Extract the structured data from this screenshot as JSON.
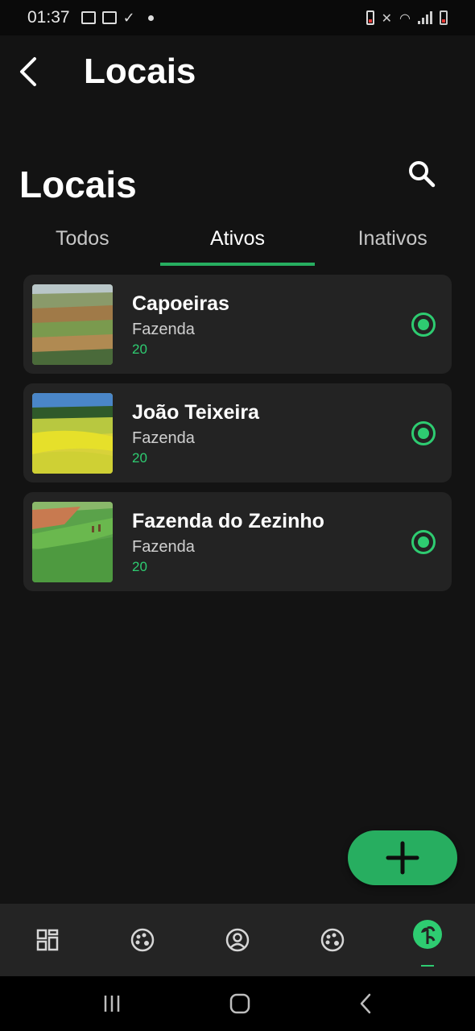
{
  "status_bar": {
    "time": "01:37"
  },
  "app_bar": {
    "title": "Locais"
  },
  "section": {
    "title": "Locais"
  },
  "tabs": [
    {
      "label": "Todos",
      "active": false
    },
    {
      "label": "Ativos",
      "active": true
    },
    {
      "label": "Inativos",
      "active": false
    }
  ],
  "locations": [
    {
      "name": "Capoeiras",
      "type": "Fazenda",
      "count": "20",
      "selected": true
    },
    {
      "name": "João Teixeira",
      "type": "Fazenda",
      "count": "20",
      "selected": true
    },
    {
      "name": "Fazenda do Zezinho",
      "type": "Fazenda",
      "count": "20",
      "selected": true
    }
  ],
  "nav": {
    "items": [
      "grid-icon",
      "palette-icon",
      "user-circle-icon",
      "palette-icon",
      "plant-icon"
    ],
    "active_index": 4
  },
  "colors": {
    "accent": "#27ae60",
    "background": "#131313",
    "card": "#232323",
    "nav": "#242424"
  }
}
